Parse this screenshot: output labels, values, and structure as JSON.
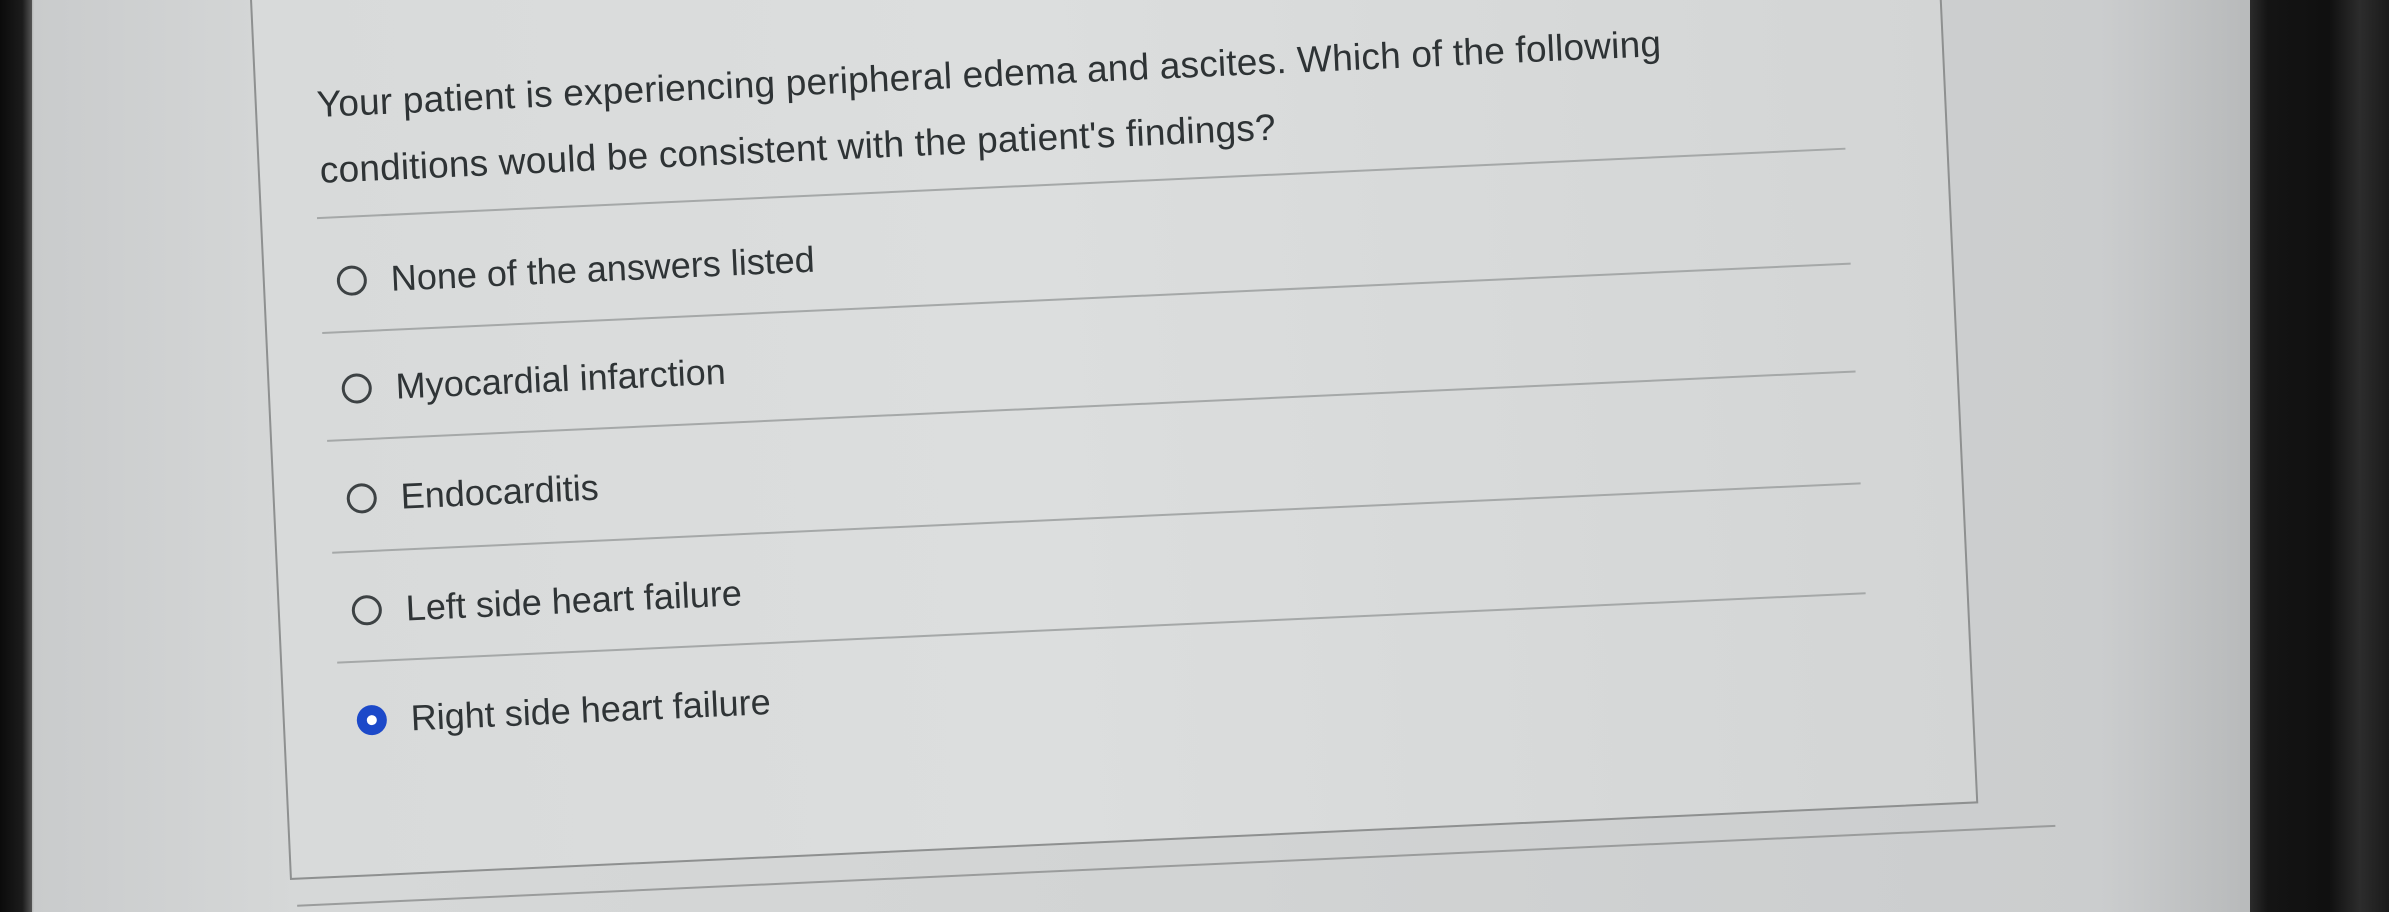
{
  "question": {
    "line1": "Your patient is experiencing peripheral edema and ascites. Which of the following",
    "line2": "conditions would be consistent with the patient's findings?"
  },
  "options": [
    {
      "label": "None of the answers listed",
      "selected": false
    },
    {
      "label": "Myocardial infarction",
      "selected": false
    },
    {
      "label": "Endocarditis",
      "selected": false
    },
    {
      "label": "Left side heart failure",
      "selected": false
    },
    {
      "label": "Right side heart failure",
      "selected": true
    }
  ],
  "colors": {
    "selected_radio": "#1c49c9",
    "text": "#2e3335",
    "card_background": "#d8dada"
  }
}
